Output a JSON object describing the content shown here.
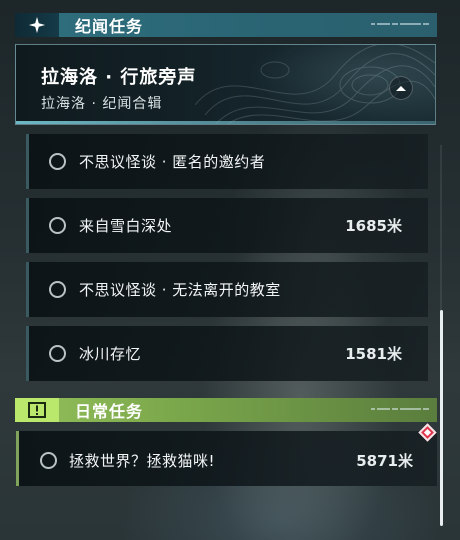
{
  "world_section": {
    "title": "纪闻任务",
    "icon": "sparkle-star-icon",
    "header_color": "#2f6f7e",
    "group": {
      "title": "拉海洛 · 行旅旁声",
      "subtitle": "拉海洛 · 纪闻合辑",
      "collapse_icon": "chevron-up-icon"
    },
    "quests": [
      {
        "name": "不思议怪谈 · 匿名的邀约者",
        "distance": ""
      },
      {
        "name": "来自雪白深处",
        "distance": "1685米"
      },
      {
        "name": "不思议怪谈 · 无法离开的教室",
        "distance": ""
      },
      {
        "name": "冰川存忆",
        "distance": "1581米"
      }
    ]
  },
  "daily_section": {
    "title": "日常任务",
    "icon": "exclamation-box-icon",
    "header_color": "#93c05a",
    "quests": [
      {
        "name": "拯救世界？拯救猫咪!",
        "distance": "5871米",
        "tracked": true
      }
    ],
    "tracked_marker_color": "#e0364d"
  }
}
